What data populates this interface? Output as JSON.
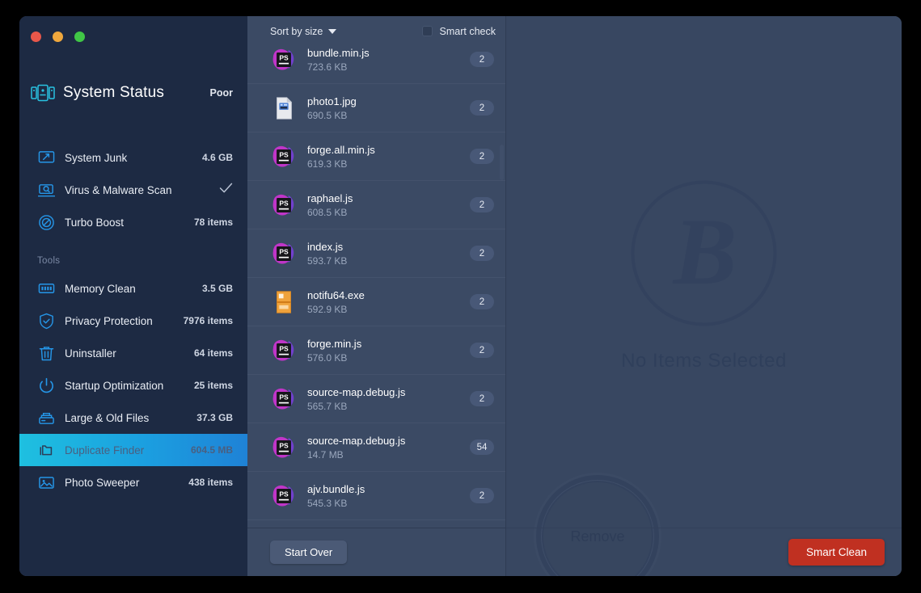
{
  "window": {
    "controls": [
      "close",
      "minimize",
      "maximize"
    ]
  },
  "sidebar": {
    "status": {
      "icon": "system-status-icon",
      "title": "System Status",
      "value": "Poor"
    },
    "primary_items": [
      {
        "icon": "system-junk-icon",
        "label": "System Junk",
        "value": "4.6 GB",
        "state": "value"
      },
      {
        "icon": "virus-scan-icon",
        "label": "Virus & Malware Scan",
        "value": "",
        "state": "check"
      },
      {
        "icon": "turbo-boost-icon",
        "label": "Turbo Boost",
        "value": "78 items",
        "state": "value"
      }
    ],
    "tools_label": "Tools",
    "tool_items": [
      {
        "icon": "memory-clean-icon",
        "label": "Memory Clean",
        "value": "3.5 GB",
        "active": false
      },
      {
        "icon": "privacy-protection-icon",
        "label": "Privacy Protection",
        "value": "7976 items",
        "active": false
      },
      {
        "icon": "uninstaller-icon",
        "label": "Uninstaller",
        "value": "64 items",
        "active": false
      },
      {
        "icon": "startup-optimization-icon",
        "label": "Startup Optimization",
        "value": "25 items",
        "active": false
      },
      {
        "icon": "large-old-files-icon",
        "label": "Large & Old Files",
        "value": "37.3 GB",
        "active": false
      },
      {
        "icon": "duplicate-finder-icon",
        "label": "Duplicate Finder",
        "value": "604.5 MB",
        "active": true
      },
      {
        "icon": "photo-sweeper-icon",
        "label": "Photo Sweeper",
        "value": "438 items",
        "active": false
      }
    ]
  },
  "list": {
    "sort_label": "Sort by size",
    "sort_caret_icon": "chevron-down-icon",
    "smart_check_label": "Smart check",
    "smart_check_checked": false,
    "files": [
      {
        "icon": "phpstorm-file-icon",
        "name": "bundle.min.js",
        "size": "723.6 KB",
        "count": "2"
      },
      {
        "icon": "document-file-icon",
        "name": "photo1.jpg",
        "size": "690.5 KB",
        "count": "2"
      },
      {
        "icon": "phpstorm-file-icon",
        "name": "forge.all.min.js",
        "size": "619.3 KB",
        "count": "2"
      },
      {
        "icon": "phpstorm-file-icon",
        "name": "raphael.js",
        "size": "608.5 KB",
        "count": "2"
      },
      {
        "icon": "phpstorm-file-icon",
        "name": "index.js",
        "size": "593.7 KB",
        "count": "2"
      },
      {
        "icon": "exe-file-icon",
        "name": "notifu64.exe",
        "size": "592.9 KB",
        "count": "2"
      },
      {
        "icon": "phpstorm-file-icon",
        "name": "forge.min.js",
        "size": "576.0 KB",
        "count": "2"
      },
      {
        "icon": "phpstorm-file-icon",
        "name": "source-map.debug.js",
        "size": "565.7 KB",
        "count": "2"
      },
      {
        "icon": "phpstorm-file-icon",
        "name": "source-map.debug.js",
        "size": "14.7 MB",
        "count": "54"
      },
      {
        "icon": "phpstorm-file-icon",
        "name": "ajv.bundle.js",
        "size": "545.3 KB",
        "count": "2"
      }
    ],
    "start_over_label": "Start Over"
  },
  "detail": {
    "empty_logo_letter": "B",
    "empty_text": "No Items Selected",
    "remove_label": "Remove",
    "smart_clean_label": "Smart Clean"
  },
  "colors": {
    "sidebar_bg": "#1d2a43",
    "list_bg": "#3b4a64",
    "detail_bg": "#384761",
    "accent_cyan": "#29c3e2",
    "accent_blue": "#1f82d6",
    "danger_red": "#c03021",
    "text_primary": "#ffffff",
    "text_muted": "#9aa7bd"
  }
}
